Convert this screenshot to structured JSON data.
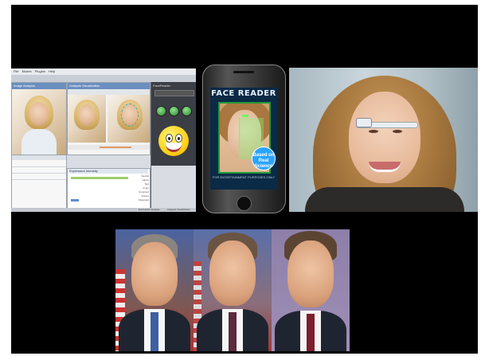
{
  "software": {
    "menu": [
      "File",
      "Modes",
      "Plugins",
      "Help"
    ],
    "window_left_title": "Image Analysis",
    "window_right_title": "Analysis Visualization",
    "side_panel_title": "FaceReader",
    "bottom_panel_title": "Expression Intensity",
    "expressions": [
      "Neutral",
      "Happy",
      "Sad",
      "Angry",
      "Surprised",
      "Scared",
      "Disgusted"
    ],
    "status_left": "Expression Analysis",
    "status_right": "Analysis Visualization"
  },
  "phone_app": {
    "title": "FACE READER",
    "badge": "Based on Real Science",
    "footer": "FOR ENTERTAINMENT PURPOSES ONLY"
  },
  "colors": {
    "slide_bg": "#000000",
    "page_bg": "#ffffff",
    "accent_green": "#1f9a3a",
    "badge_blue": "#2aa4ff"
  }
}
